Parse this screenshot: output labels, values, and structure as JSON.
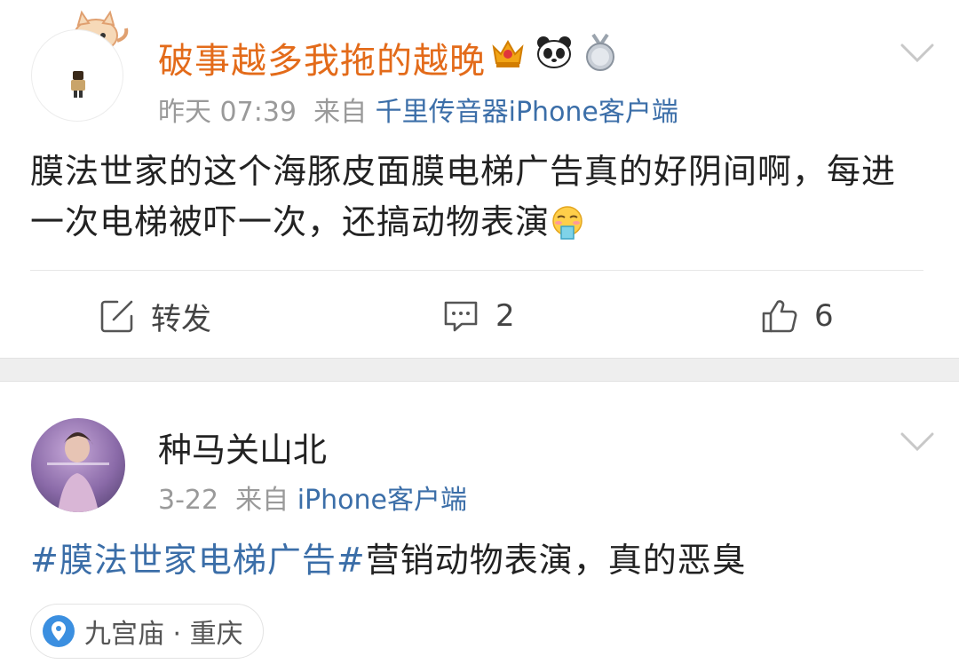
{
  "post1": {
    "username": "破事越多我拖的越晚",
    "badges": [
      "crown-vip-icon",
      "panda-icon",
      "medal-icon"
    ],
    "time": "昨天 07:39",
    "from_label": "来自",
    "source": "千里传音器iPhone客户端",
    "text": "膜法世家的这个海豚皮面膜电梯广告真的好阴间啊，每进一次电梯被吓一次，还搞动物表演",
    "emoji": "vomit-emoji",
    "actions": {
      "repost_label": "转发",
      "comment_count": "2",
      "like_count": "6"
    }
  },
  "post2": {
    "username": "种马关山北",
    "time": "3-22",
    "from_label": "来自",
    "source": "iPhone客户端",
    "topic": "#膜法世家电梯广告#",
    "text": "营销动物表演，真的恶臭",
    "location": "九宫庙 · 重庆"
  },
  "colors": {
    "vip_name": "#e36b1a",
    "link_blue": "#3b6ea8",
    "meta_gray": "#9a9a9a",
    "separator": "#eeeeee"
  }
}
